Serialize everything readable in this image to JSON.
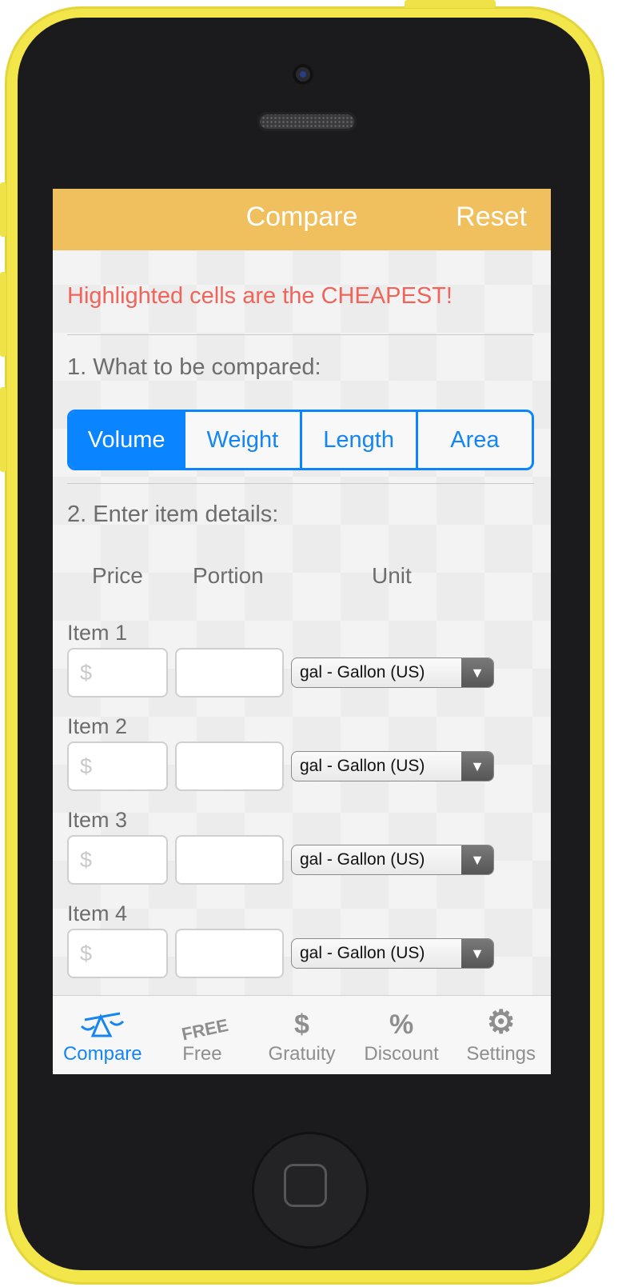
{
  "navbar": {
    "title": "Compare",
    "reset_label": "Reset"
  },
  "notice": "Highlighted cells are the CHEAPEST!",
  "section1": "1. What to be compared:",
  "segments": [
    "Volume",
    "Weight",
    "Length",
    "Area"
  ],
  "section2": "2. Enter item details:",
  "columns": {
    "price": "Price",
    "portion": "Portion",
    "unit": "Unit"
  },
  "items": [
    {
      "label": "Item 1",
      "price_placeholder": "$",
      "portion_value": "",
      "unit": "gal - Gallon (US)"
    },
    {
      "label": "Item 2",
      "price_placeholder": "$",
      "portion_value": "",
      "unit": "gal - Gallon (US)"
    },
    {
      "label": "Item 3",
      "price_placeholder": "$",
      "portion_value": "",
      "unit": "gal - Gallon (US)"
    },
    {
      "label": "Item 4",
      "price_placeholder": "$",
      "portion_value": "",
      "unit": "gal - Gallon (US)"
    }
  ],
  "tabs": [
    {
      "label": "Compare",
      "icon": "scale-icon",
      "active": true
    },
    {
      "label": "Free",
      "icon": "free-stamp-icon",
      "glyph": "FREE"
    },
    {
      "label": "Gratuity",
      "icon": "dollar-icon",
      "glyph": "$"
    },
    {
      "label": "Discount",
      "icon": "percent-icon",
      "glyph": "%"
    },
    {
      "label": "Settings",
      "icon": "gear-icon",
      "glyph": "⚙"
    }
  ],
  "colors": {
    "navbar": "#f0bf5e",
    "accent": "#0a84ff",
    "notice": "#f0645a",
    "frame": "#f2e64a"
  }
}
